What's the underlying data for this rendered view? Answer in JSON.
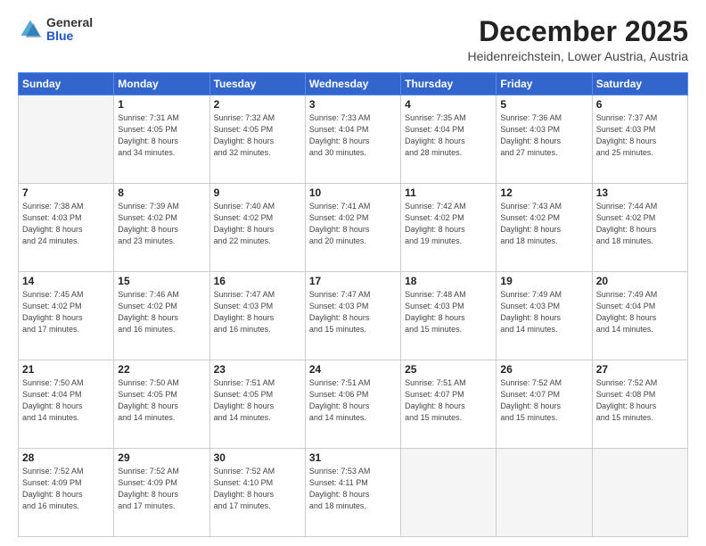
{
  "header": {
    "logo_general": "General",
    "logo_blue": "Blue",
    "month_title": "December 2025",
    "subtitle": "Heidenreichstein, Lower Austria, Austria"
  },
  "weekdays": [
    "Sunday",
    "Monday",
    "Tuesday",
    "Wednesday",
    "Thursday",
    "Friday",
    "Saturday"
  ],
  "weeks": [
    [
      {
        "day": "",
        "info": ""
      },
      {
        "day": "1",
        "info": "Sunrise: 7:31 AM\nSunset: 4:05 PM\nDaylight: 8 hours\nand 34 minutes."
      },
      {
        "day": "2",
        "info": "Sunrise: 7:32 AM\nSunset: 4:05 PM\nDaylight: 8 hours\nand 32 minutes."
      },
      {
        "day": "3",
        "info": "Sunrise: 7:33 AM\nSunset: 4:04 PM\nDaylight: 8 hours\nand 30 minutes."
      },
      {
        "day": "4",
        "info": "Sunrise: 7:35 AM\nSunset: 4:04 PM\nDaylight: 8 hours\nand 28 minutes."
      },
      {
        "day": "5",
        "info": "Sunrise: 7:36 AM\nSunset: 4:03 PM\nDaylight: 8 hours\nand 27 minutes."
      },
      {
        "day": "6",
        "info": "Sunrise: 7:37 AM\nSunset: 4:03 PM\nDaylight: 8 hours\nand 25 minutes."
      }
    ],
    [
      {
        "day": "7",
        "info": "Sunrise: 7:38 AM\nSunset: 4:03 PM\nDaylight: 8 hours\nand 24 minutes."
      },
      {
        "day": "8",
        "info": "Sunrise: 7:39 AM\nSunset: 4:02 PM\nDaylight: 8 hours\nand 23 minutes."
      },
      {
        "day": "9",
        "info": "Sunrise: 7:40 AM\nSunset: 4:02 PM\nDaylight: 8 hours\nand 22 minutes."
      },
      {
        "day": "10",
        "info": "Sunrise: 7:41 AM\nSunset: 4:02 PM\nDaylight: 8 hours\nand 20 minutes."
      },
      {
        "day": "11",
        "info": "Sunrise: 7:42 AM\nSunset: 4:02 PM\nDaylight: 8 hours\nand 19 minutes."
      },
      {
        "day": "12",
        "info": "Sunrise: 7:43 AM\nSunset: 4:02 PM\nDaylight: 8 hours\nand 18 minutes."
      },
      {
        "day": "13",
        "info": "Sunrise: 7:44 AM\nSunset: 4:02 PM\nDaylight: 8 hours\nand 18 minutes."
      }
    ],
    [
      {
        "day": "14",
        "info": "Sunrise: 7:45 AM\nSunset: 4:02 PM\nDaylight: 8 hours\nand 17 minutes."
      },
      {
        "day": "15",
        "info": "Sunrise: 7:46 AM\nSunset: 4:02 PM\nDaylight: 8 hours\nand 16 minutes."
      },
      {
        "day": "16",
        "info": "Sunrise: 7:47 AM\nSunset: 4:03 PM\nDaylight: 8 hours\nand 16 minutes."
      },
      {
        "day": "17",
        "info": "Sunrise: 7:47 AM\nSunset: 4:03 PM\nDaylight: 8 hours\nand 15 minutes."
      },
      {
        "day": "18",
        "info": "Sunrise: 7:48 AM\nSunset: 4:03 PM\nDaylight: 8 hours\nand 15 minutes."
      },
      {
        "day": "19",
        "info": "Sunrise: 7:49 AM\nSunset: 4:03 PM\nDaylight: 8 hours\nand 14 minutes."
      },
      {
        "day": "20",
        "info": "Sunrise: 7:49 AM\nSunset: 4:04 PM\nDaylight: 8 hours\nand 14 minutes."
      }
    ],
    [
      {
        "day": "21",
        "info": "Sunrise: 7:50 AM\nSunset: 4:04 PM\nDaylight: 8 hours\nand 14 minutes."
      },
      {
        "day": "22",
        "info": "Sunrise: 7:50 AM\nSunset: 4:05 PM\nDaylight: 8 hours\nand 14 minutes."
      },
      {
        "day": "23",
        "info": "Sunrise: 7:51 AM\nSunset: 4:05 PM\nDaylight: 8 hours\nand 14 minutes."
      },
      {
        "day": "24",
        "info": "Sunrise: 7:51 AM\nSunset: 4:06 PM\nDaylight: 8 hours\nand 14 minutes."
      },
      {
        "day": "25",
        "info": "Sunrise: 7:51 AM\nSunset: 4:07 PM\nDaylight: 8 hours\nand 15 minutes."
      },
      {
        "day": "26",
        "info": "Sunrise: 7:52 AM\nSunset: 4:07 PM\nDaylight: 8 hours\nand 15 minutes."
      },
      {
        "day": "27",
        "info": "Sunrise: 7:52 AM\nSunset: 4:08 PM\nDaylight: 8 hours\nand 15 minutes."
      }
    ],
    [
      {
        "day": "28",
        "info": "Sunrise: 7:52 AM\nSunset: 4:09 PM\nDaylight: 8 hours\nand 16 minutes."
      },
      {
        "day": "29",
        "info": "Sunrise: 7:52 AM\nSunset: 4:09 PM\nDaylight: 8 hours\nand 17 minutes."
      },
      {
        "day": "30",
        "info": "Sunrise: 7:52 AM\nSunset: 4:10 PM\nDaylight: 8 hours\nand 17 minutes."
      },
      {
        "day": "31",
        "info": "Sunrise: 7:53 AM\nSunset: 4:11 PM\nDaylight: 8 hours\nand 18 minutes."
      },
      {
        "day": "",
        "info": ""
      },
      {
        "day": "",
        "info": ""
      },
      {
        "day": "",
        "info": ""
      }
    ]
  ]
}
